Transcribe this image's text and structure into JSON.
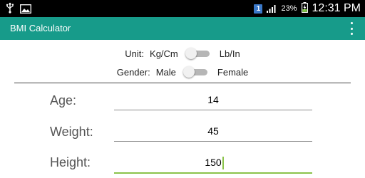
{
  "status_bar": {
    "notification_count": "1",
    "battery": "23%",
    "time": "12:31 PM"
  },
  "app": {
    "title": "BMI Calculator"
  },
  "unit": {
    "label": "Unit:",
    "option_off": "Kg/Cm",
    "option_on": "Lb/In",
    "toggle_on": false
  },
  "gender": {
    "label": "Gender:",
    "option_off": "Male",
    "option_on": "Female",
    "toggle_on": false
  },
  "fields": {
    "age": {
      "label": "Age:",
      "value": "14"
    },
    "weight": {
      "label": "Weight:",
      "value": "45"
    },
    "height": {
      "label": "Height:",
      "value": "150"
    }
  },
  "colors": {
    "action_bar": "#179b8a",
    "focus_underline": "#8bc34a"
  }
}
